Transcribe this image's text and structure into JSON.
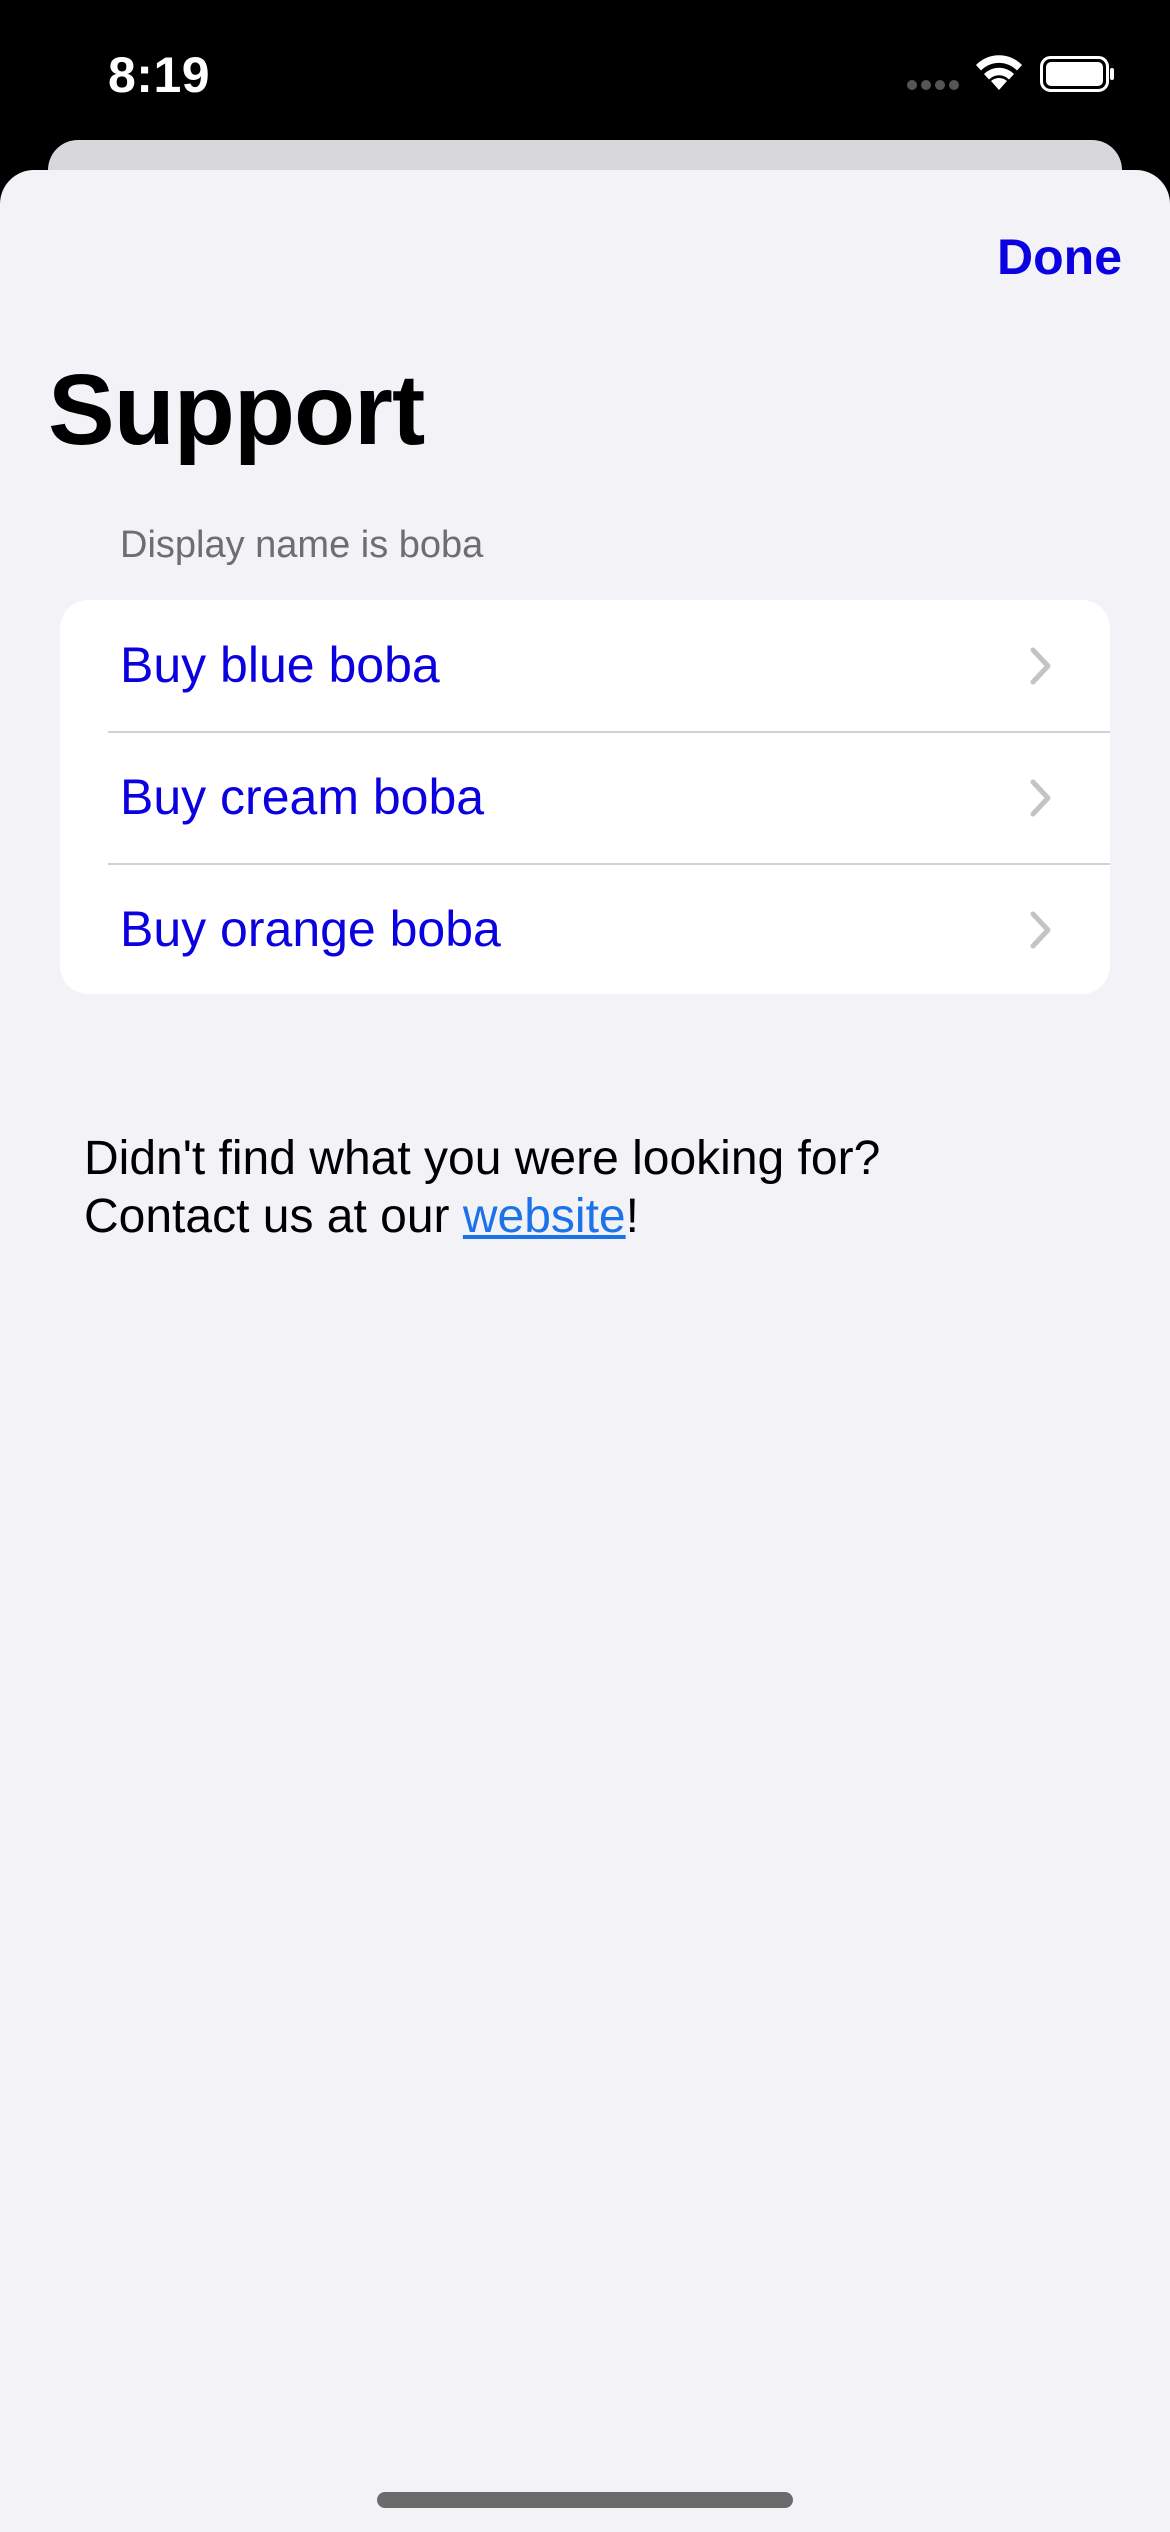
{
  "status_bar": {
    "time": "8:19"
  },
  "sheet": {
    "done_label": "Done",
    "title": "Support",
    "section_header": "Display name is boba",
    "items": [
      {
        "label": "Buy blue boba"
      },
      {
        "label": "Buy cream boba"
      },
      {
        "label": "Buy orange boba"
      }
    ],
    "footer": {
      "line1": "Didn't find what you were looking for?",
      "line2_prefix": "Contact us at our ",
      "link_text": "website",
      "line2_suffix": "!"
    }
  },
  "colors": {
    "accent": "#0b00e0",
    "link": "#1a73e8",
    "background": "#f2f2f7",
    "secondary_text": "#6d6d72"
  },
  "icons": [
    "wifi-icon",
    "battery-icon",
    "chevron-right-icon"
  ]
}
